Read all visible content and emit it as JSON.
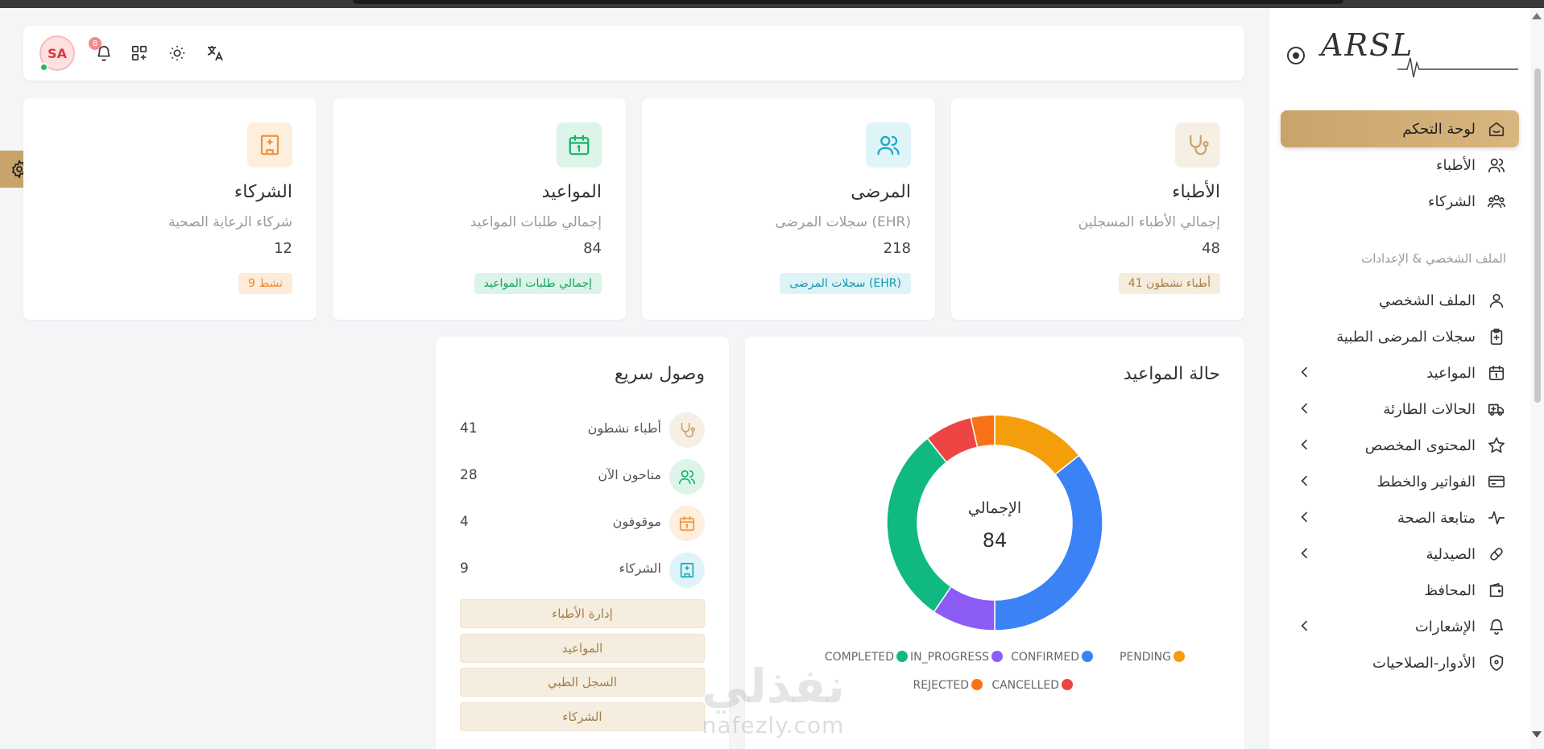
{
  "brand": {
    "logo_text": "ARSL"
  },
  "header": {
    "avatar_initials": "SA",
    "notification_count": "8"
  },
  "sidebar": {
    "items": [
      {
        "label": "لوحة التحكم",
        "icon": "home-icon",
        "active": true
      },
      {
        "label": "الأطباء",
        "icon": "users-icon"
      },
      {
        "label": "الشركاء",
        "icon": "partners-icon"
      },
      {
        "label": "الملف الشخصي",
        "icon": "user-icon"
      },
      {
        "label": "سجلات المرضى الطبية",
        "icon": "clipboard-icon"
      },
      {
        "label": "المواعيد",
        "icon": "calendar-icon",
        "chevron": true
      },
      {
        "label": "الحالات الطارئة",
        "icon": "ambulance-icon",
        "chevron": true
      },
      {
        "label": "المحتوى المخصص",
        "icon": "star-icon",
        "chevron": true
      },
      {
        "label": "الفواتير والخطط",
        "icon": "card-icon",
        "chevron": true
      },
      {
        "label": "متابعة الصحة",
        "icon": "pulse-icon",
        "chevron": true
      },
      {
        "label": "الصيدلية",
        "icon": "pill-icon",
        "chevron": true
      },
      {
        "label": "المحافظ",
        "icon": "wallet-icon"
      },
      {
        "label": "الإشعارات",
        "icon": "bell-icon",
        "chevron": true
      },
      {
        "label": "الأدوار-الصلاحيات",
        "icon": "shield-icon"
      }
    ],
    "section_label": "الملف الشخصي & الإعدادات"
  },
  "cards": [
    {
      "title": "الأطباء",
      "subtitle": "إجمالي الأطباء المسجلين",
      "value": "48",
      "badge": "41 أطباء نشطون",
      "icon": "stethoscope-icon",
      "color": "#c9a46a",
      "bg": "#f6efe4",
      "badge_bg": "#f5ecdd",
      "badge_color": "#a57f47"
    },
    {
      "title": "المرضى",
      "subtitle": "سجلات المرضى (EHR)",
      "value": "218",
      "badge": "سجلات المرضى (EHR)",
      "icon": "patients-icon",
      "color": "#1aa8c4",
      "bg": "#dff4f8",
      "badge_bg": "#ddf3f7",
      "badge_color": "#1596ae"
    },
    {
      "title": "المواعيد",
      "subtitle": "إجمالي طلبات المواعيد",
      "value": "84",
      "badge": "إجمالي طلبات المواعيد",
      "icon": "calendar-icon",
      "color": "#19b36b",
      "bg": "#dcf5e8",
      "badge_bg": "#dcf4e7",
      "badge_color": "#17a061"
    },
    {
      "title": "الشركاء",
      "subtitle": "شركاء الرعاية الصحية",
      "value": "12",
      "badge": "9 نشط",
      "icon": "building-icon",
      "color": "#f0953a",
      "bg": "#fdeedd",
      "badge_bg": "#fdecd9",
      "badge_color": "#e88a2e"
    }
  ],
  "chart": {
    "title": "حالة المواعيد",
    "center_label": "الإجمالي",
    "center_value": "84"
  },
  "chart_data": {
    "type": "pie",
    "title": "حالة المواعيد",
    "total": 84,
    "series": [
      {
        "name": "PENDING",
        "value": 12,
        "color": "#f59e0b"
      },
      {
        "name": "CONFIRMED",
        "value": 30,
        "color": "#3b82f6"
      },
      {
        "name": "IN_PROGRESS",
        "value": 8,
        "color": "#8b5cf6"
      },
      {
        "name": "COMPLETED",
        "value": 25,
        "color": "#10b981"
      },
      {
        "name": "CANCELLED",
        "value": 6,
        "color": "#ef4444"
      },
      {
        "name": "REJECTED",
        "value": 3,
        "color": "#f97316"
      }
    ]
  },
  "quick": {
    "title": "وصول سريع",
    "rows": [
      {
        "label": "أطباء نشطون",
        "value": "41",
        "icon": "stethoscope-icon",
        "color": "#c9a46a",
        "bg": "#f6efe4"
      },
      {
        "label": "متاحون الآن",
        "value": "28",
        "icon": "users-icon",
        "color": "#19b36b",
        "bg": "#dcf5e8"
      },
      {
        "label": "موقوفون",
        "value": "4",
        "icon": "calendar-icon",
        "color": "#f0953a",
        "bg": "#fdeedd"
      },
      {
        "label": "الشركاء",
        "value": "9",
        "icon": "building-icon",
        "color": "#1aa8c4",
        "bg": "#dff4f8"
      }
    ],
    "buttons": [
      "إدارة الأطباء",
      "المواعيد",
      "السجل الطبي",
      "الشركاء"
    ]
  },
  "watermark": {
    "ar": "نفذلي",
    "en": "nafezly.com"
  }
}
